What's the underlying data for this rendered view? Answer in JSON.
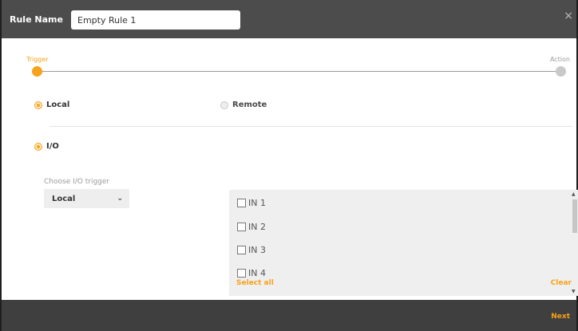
{
  "header": {
    "label": "Rule Name",
    "rule_name_value": "Empty Rule 1",
    "close_glyph": "×"
  },
  "stepper": {
    "steps": [
      "Trigger",
      "Action"
    ],
    "active_step": "Trigger"
  },
  "location": {
    "options": [
      {
        "label": "Local",
        "selected": true
      },
      {
        "label": "Remote",
        "selected": false
      }
    ]
  },
  "trigger_type": {
    "label": "I/O",
    "selected": true
  },
  "io_trigger": {
    "label": "Choose I/O trigger",
    "selected_value": "Local",
    "chevron": "⌄"
  },
  "io_list": {
    "items": [
      "IN 1",
      "IN 2",
      "IN 3",
      "IN 4"
    ],
    "select_all_label": "Select all",
    "clear_label": "Clear"
  },
  "footer": {
    "next_label": "Next"
  },
  "colors": {
    "accent": "#f7a21b",
    "header_bg": "#4c4c4c",
    "footer_bg": "#3f3f3f"
  }
}
